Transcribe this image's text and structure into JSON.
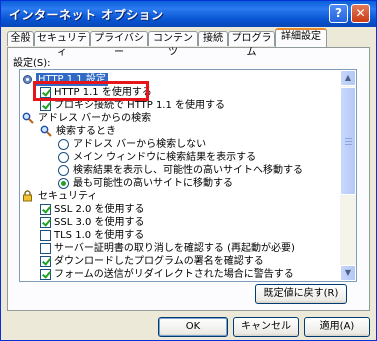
{
  "window": {
    "title": "インターネット オプション",
    "help_label": "?",
    "close_label": "✕"
  },
  "tabs": [
    {
      "label": "全般"
    },
    {
      "label": "セキュリティ"
    },
    {
      "label": "プライバシー"
    },
    {
      "label": "コンテンツ"
    },
    {
      "label": "接続"
    },
    {
      "label": "プログラム"
    },
    {
      "label": "詳細設定"
    }
  ],
  "settings_label": "設定(S):",
  "tree": [
    {
      "label": "HTTP 1.1 設定",
      "icon": "gear-icon"
    },
    {
      "label": "HTTP 1.1 を使用する",
      "checked": true
    },
    {
      "label": "プロキシ接続で HTTP 1.1 を使用する",
      "checked": true
    },
    {
      "label": "アドレス バーからの検索",
      "icon": "search-icon"
    },
    {
      "label": "検索するとき",
      "icon": "search-icon"
    },
    {
      "label": "アドレス バーから検索しない",
      "checked": false
    },
    {
      "label": "メイン ウィンドウに検索結果を表示する",
      "checked": false
    },
    {
      "label": "検索結果を表示し、可能性の高いサイトへ移動する",
      "checked": false
    },
    {
      "label": "最も可能性の高いサイトに移動する",
      "checked": true
    },
    {
      "label": "セキュリティ",
      "icon": "lock-icon"
    },
    {
      "label": "SSL 2.0 を使用する",
      "checked": true
    },
    {
      "label": "SSL 3.0 を使用する",
      "checked": true
    },
    {
      "label": "TLS 1.0 を使用する",
      "checked": false
    },
    {
      "label": "サーバー証明書の取り消しを確認する (再起動が必要)",
      "checked": false
    },
    {
      "label": "ダウンロードしたプログラムの署名を確認する",
      "checked": true
    },
    {
      "label": "フォームの送信がリダイレクトされた場合に警告する",
      "checked": true
    }
  ],
  "buttons": {
    "restore_defaults": "既定値に戻す(R)",
    "ok": "OK",
    "cancel": "キャンセル",
    "apply": "適用(A)"
  },
  "colors": {
    "title_bar": "#0a5fd8",
    "highlight": "#e8141b",
    "check": "#21a121"
  }
}
